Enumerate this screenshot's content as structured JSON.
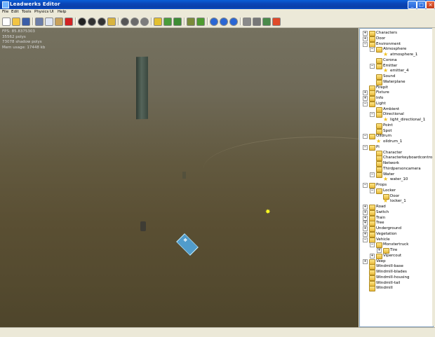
{
  "window": {
    "title": "Leadwerks Editor",
    "minimize": "_",
    "maximize": "□",
    "close": "×"
  },
  "menu": [
    "File",
    "Edit",
    "Tools",
    "Physics",
    "UI",
    "Help"
  ],
  "toolbar": {
    "buttons": [
      {
        "name": "new-file-icon",
        "color": "#ffffff"
      },
      {
        "name": "open-folder-icon",
        "color": "#f2c443"
      },
      {
        "name": "save-icon",
        "color": "#3b5ea8"
      },
      {
        "name": "cut-icon",
        "color": "#6c7ea8"
      },
      {
        "name": "copy-icon",
        "color": "#dfe6f4"
      },
      {
        "name": "paste-icon",
        "color": "#c9a15a"
      },
      {
        "name": "delete-icon",
        "color": "#d22222"
      },
      {
        "name": "select-move-icon",
        "color": "#222222"
      },
      {
        "name": "rotate-icon",
        "color": "#333333"
      },
      {
        "name": "scale-icon",
        "color": "#333333"
      },
      {
        "name": "paint-icon",
        "color": "#d8b440"
      },
      {
        "name": "sphere-dark-icon",
        "color": "#555555"
      },
      {
        "name": "sphere-mid-icon",
        "color": "#6a6a6a"
      },
      {
        "name": "sphere-light-icon",
        "color": "#7c7c7c"
      },
      {
        "name": "brush-icon",
        "color": "#e3c030"
      },
      {
        "name": "terrain-paint-icon",
        "color": "#4a9c3a"
      },
      {
        "name": "terrain-raise-icon",
        "color": "#3e8c34"
      },
      {
        "name": "road-icon",
        "color": "#7a8a3a"
      },
      {
        "name": "vegetation-icon",
        "color": "#4e9a30"
      },
      {
        "name": "play-icon",
        "color": "#2a66d4"
      },
      {
        "name": "pause-icon",
        "color": "#2a66d4"
      },
      {
        "name": "stop-icon",
        "color": "#2a66d4"
      },
      {
        "name": "wand-icon",
        "color": "#8a8a8a"
      },
      {
        "name": "hand-icon",
        "color": "#777777"
      },
      {
        "name": "tools-icon",
        "color": "#4a8a4a"
      },
      {
        "name": "lifebuoy-icon",
        "color": "#e04a2a"
      }
    ]
  },
  "viewport": {
    "stats": [
      "FPS: 85.8375303",
      "35562 polys",
      "73078 shadow polys",
      "Mem usage: 17448 kb"
    ],
    "water_icon": "❖",
    "light_icon": "✸"
  },
  "scene_tree": [
    {
      "label": "Characters",
      "depth": 0,
      "kind": "folder",
      "toggle": "+"
    },
    {
      "label": "Door",
      "depth": 0,
      "kind": "folder",
      "toggle": "+"
    },
    {
      "label": "Environment",
      "depth": 0,
      "kind": "folder",
      "toggle": "−"
    },
    {
      "label": "Atmosphere",
      "depth": 1,
      "kind": "folder",
      "toggle": "−"
    },
    {
      "label": "atmosphere_1",
      "depth": 2,
      "kind": "item",
      "toggle": ""
    },
    {
      "label": "Corona",
      "depth": 1,
      "kind": "folder",
      "toggle": ""
    },
    {
      "label": "Emitter",
      "depth": 1,
      "kind": "folder",
      "toggle": "−"
    },
    {
      "label": "emitter_4",
      "depth": 2,
      "kind": "item",
      "toggle": ""
    },
    {
      "label": "Sound",
      "depth": 1,
      "kind": "folder",
      "toggle": ""
    },
    {
      "label": "Waterplane",
      "depth": 1,
      "kind": "folder",
      "toggle": ""
    },
    {
      "label": "Firepit",
      "depth": 0,
      "kind": "folder",
      "toggle": ""
    },
    {
      "label": "Fixture",
      "depth": 0,
      "kind": "folder",
      "toggle": "+"
    },
    {
      "label": "Info",
      "depth": 0,
      "kind": "folder",
      "toggle": "+"
    },
    {
      "label": "Light",
      "depth": 0,
      "kind": "folder",
      "toggle": "−"
    },
    {
      "label": "Ambient",
      "depth": 1,
      "kind": "folder",
      "toggle": ""
    },
    {
      "label": "Directional",
      "depth": 1,
      "kind": "folder",
      "toggle": "−"
    },
    {
      "label": "light_directional_1",
      "depth": 2,
      "kind": "item",
      "toggle": ""
    },
    {
      "label": "Point",
      "depth": 1,
      "kind": "folder",
      "toggle": ""
    },
    {
      "label": "Spot",
      "depth": 1,
      "kind": "folder",
      "toggle": ""
    },
    {
      "label": "Oildrum",
      "depth": 0,
      "kind": "folder",
      "toggle": "−"
    },
    {
      "label": "oildrum_1",
      "depth": 1,
      "kind": "item",
      "toggle": ""
    },
    {
      "label": "Pi",
      "depth": 0,
      "kind": "folder",
      "toggle": "−"
    },
    {
      "label": "Character",
      "depth": 1,
      "kind": "folder",
      "toggle": ""
    },
    {
      "label": "Characterkeyboardcontrols",
      "depth": 1,
      "kind": "folder",
      "toggle": ""
    },
    {
      "label": "Network",
      "depth": 1,
      "kind": "folder",
      "toggle": ""
    },
    {
      "label": "Thirdpersoncamera",
      "depth": 1,
      "kind": "folder",
      "toggle": ""
    },
    {
      "label": "Water",
      "depth": 1,
      "kind": "folder",
      "toggle": "−"
    },
    {
      "label": "water_10",
      "depth": 2,
      "kind": "item",
      "toggle": ""
    },
    {
      "label": "Props",
      "depth": 0,
      "kind": "folder",
      "toggle": "−"
    },
    {
      "label": "Locker",
      "depth": 1,
      "kind": "folder",
      "toggle": "−"
    },
    {
      "label": "Door",
      "depth": 2,
      "kind": "folder",
      "toggle": ""
    },
    {
      "label": "locker_1",
      "depth": 2,
      "kind": "item",
      "toggle": ""
    },
    {
      "label": "Road",
      "depth": 0,
      "kind": "folder",
      "toggle": "+"
    },
    {
      "label": "Switch",
      "depth": 0,
      "kind": "folder",
      "toggle": "+"
    },
    {
      "label": "Train",
      "depth": 0,
      "kind": "folder",
      "toggle": "+"
    },
    {
      "label": "Tree",
      "depth": 0,
      "kind": "folder",
      "toggle": "+"
    },
    {
      "label": "Underground",
      "depth": 0,
      "kind": "folder",
      "toggle": "+"
    },
    {
      "label": "Vegetation",
      "depth": 0,
      "kind": "folder",
      "toggle": "+"
    },
    {
      "label": "Vehicle",
      "depth": 0,
      "kind": "folder",
      "toggle": "−"
    },
    {
      "label": "Monstertruck",
      "depth": 1,
      "kind": "folder",
      "toggle": "−"
    },
    {
      "label": "Tire",
      "depth": 2,
      "kind": "folder",
      "toggle": "+"
    },
    {
      "label": "Vipercout",
      "depth": 1,
      "kind": "folder",
      "toggle": "+"
    },
    {
      "label": "Veep",
      "depth": 0,
      "kind": "folder",
      "toggle": "+"
    },
    {
      "label": "Windmill-base",
      "depth": 0,
      "kind": "folder",
      "toggle": ""
    },
    {
      "label": "Windmill-blades",
      "depth": 0,
      "kind": "folder",
      "toggle": ""
    },
    {
      "label": "Windmill-housing",
      "depth": 0,
      "kind": "folder",
      "toggle": ""
    },
    {
      "label": "Windmill-tail",
      "depth": 0,
      "kind": "folder",
      "toggle": ""
    },
    {
      "label": "Windmill",
      "depth": 0,
      "kind": "folder",
      "toggle": ""
    }
  ]
}
